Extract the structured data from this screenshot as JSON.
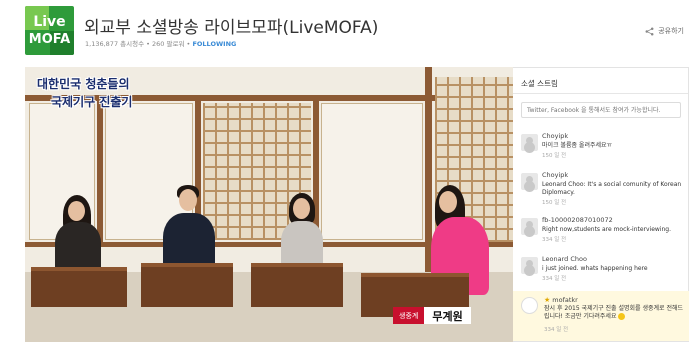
{
  "channel": {
    "logo_line1": "Live",
    "logo_line2": "MOFA",
    "title": "외교부 소셜방송 라이브모파(LiveMOFA)",
    "meta": "1,136,877 총시청수 • 260 팔로워 •",
    "follow_label": "FOLLOWING",
    "share_label": "공유하기"
  },
  "video": {
    "title_line1": "대한민국 청춘들의",
    "title_line2": "국제기구 진출기",
    "caption_tag": "생중계",
    "caption_name": "무계원"
  },
  "social": {
    "heading": "소셜 스트림",
    "input_placeholder": "Twitter, Facebook 을 통해서도 참여가 가능합니다.",
    "messages": [
      {
        "user": "Choyipk",
        "text": "마이크 볼륨좀 올려주세요ㅠ",
        "time": "150 일 전"
      },
      {
        "user": "Choyipk",
        "text": "Leonard Choo: It's a social comunity of Korean Diplomacy.",
        "time": "150 일 전"
      },
      {
        "user": "fb-100002087010072",
        "text": "Right now,students are mock-interviewing.",
        "time": "334 일 전"
      },
      {
        "user": "Leonard Choo",
        "text": "i just joined. whats happening here",
        "time": "334 일 전"
      },
      {
        "user": "mofatkr",
        "text": "잠시 후 2015 국제기구 진출 설명회를 생중계로 전해드립니다! 조금만 기다려주세요",
        "time": "334 일 전"
      }
    ]
  },
  "colors": {
    "brand_green": "#2e9b3a",
    "follow_blue": "#3a8bd6",
    "caption_red": "#c8102e",
    "highlight_bg": "#fff9df"
  }
}
